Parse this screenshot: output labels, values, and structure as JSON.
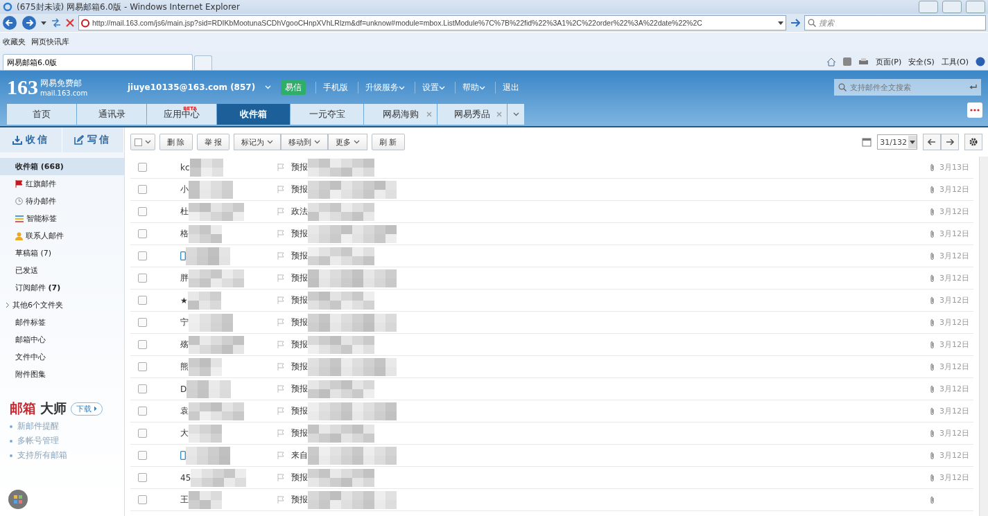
{
  "browser": {
    "title": "(675封未读) 网易邮箱6.0版 - Windows Internet Explorer",
    "address": "http://mail.163.com/js6/main.jsp?sid=RDIKbMootunaSCDhVgooCHnpXVhLRlzm&df=unknow#module=mbox.ListModule%7C%7B%22fid%22%3A1%2C%22order%22%3A%22date%22%2C",
    "search_placeholder": "搜索",
    "favorites": [
      "收藏夹",
      "网页快讯库"
    ],
    "tab": "网易邮箱6.0版",
    "commands": [
      "页面(P)",
      "安全(S)",
      "工具(O)"
    ]
  },
  "header": {
    "logo_number": "163",
    "logo_name": "网易免费邮",
    "logo_domain": "mail.163.com",
    "account": "jiuye10135@163.com (857)",
    "yixin": "易信",
    "links": [
      {
        "label": "手机版",
        "dropdown": false
      },
      {
        "label": "升级服务",
        "dropdown": true
      },
      {
        "label": "设置",
        "dropdown": true
      },
      {
        "label": "帮助",
        "dropdown": true
      },
      {
        "label": "退出",
        "dropdown": false
      }
    ],
    "search_placeholder": "支持邮件全文搜索"
  },
  "tabs": [
    {
      "label": "首页",
      "selected": false,
      "closable": false
    },
    {
      "label": "通讯录",
      "selected": false,
      "closable": false
    },
    {
      "label": "应用中心",
      "selected": false,
      "badge": "BETA",
      "closable": false
    },
    {
      "label": "收件箱",
      "selected": true,
      "closable": false
    },
    {
      "label": "一元夺宝",
      "selected": false,
      "closable": false
    },
    {
      "label": "网易海购",
      "selected": false,
      "closable": true
    },
    {
      "label": "网易秀品",
      "selected": false,
      "closable": true
    }
  ],
  "sidebar": {
    "receive": "收信",
    "write": "写信",
    "folders": [
      {
        "label": "收件箱 (668)",
        "kind": "plain",
        "selected": true,
        "expandable": false
      },
      {
        "label": "红旗邮件",
        "kind": "flag",
        "selected": false,
        "expandable": false
      },
      {
        "label": "待办邮件",
        "kind": "clock",
        "selected": false,
        "expandable": false
      },
      {
        "label": "智能标签",
        "kind": "tags",
        "selected": false,
        "expandable": false
      },
      {
        "label": "联系人邮件",
        "kind": "contact",
        "selected": false,
        "expandable": false
      },
      {
        "label": "草稿箱 (7)",
        "kind": "plain",
        "selected": false,
        "expandable": false
      },
      {
        "label": "已发送",
        "kind": "plain",
        "selected": false,
        "expandable": false
      },
      {
        "label": "订阅邮件 **(7)**",
        "kind": "plain",
        "selected": false,
        "expandable": false
      },
      {
        "label": "其他6个文件夹",
        "kind": "plain",
        "selected": false,
        "expandable": true
      },
      {
        "label": "邮件标签",
        "kind": "plain",
        "selected": false,
        "expandable": false
      },
      {
        "label": "邮箱中心",
        "kind": "plain",
        "selected": false,
        "expandable": false
      },
      {
        "label": "文件中心",
        "kind": "plain",
        "selected": false,
        "expandable": false
      },
      {
        "label": "附件图集",
        "kind": "plain",
        "selected": false,
        "expandable": false
      }
    ],
    "promo": {
      "title": [
        "邮箱",
        "大师"
      ],
      "button": "下载",
      "features": [
        "新邮件提醒",
        "多帐号管理",
        "支持所有邮箱"
      ]
    }
  },
  "toolbar": {
    "buttons": [
      {
        "label": "删 除",
        "dropdown": false,
        "group": false
      },
      {
        "label": "举 报",
        "dropdown": false,
        "group": false
      },
      {
        "label": "标记为",
        "dropdown": true,
        "group": true
      },
      {
        "label": "移动到",
        "dropdown": true,
        "group": true
      },
      {
        "label": "更多",
        "dropdown": true,
        "group": true
      },
      {
        "label": "刷 新",
        "dropdown": false,
        "group": false
      }
    ],
    "pager": "31/132"
  },
  "rows": [
    {
      "checked": false,
      "kind": "text",
      "sender": "kc",
      "subject": "预报",
      "attachment": true,
      "date": "3月13日"
    },
    {
      "checked": false,
      "kind": "text",
      "sender": "小",
      "subject": "预报",
      "attachment": true,
      "date": "3月12日"
    },
    {
      "checked": false,
      "kind": "text",
      "sender": "杜",
      "subject": "政法",
      "attachment": true,
      "date": "3月12日"
    },
    {
      "checked": false,
      "kind": "text",
      "sender": "格",
      "subject": "预报",
      "attachment": true,
      "date": "3月12日"
    },
    {
      "checked": false,
      "kind": "phone",
      "subject": "预报",
      "attachment": true,
      "date": "3月12日"
    },
    {
      "checked": false,
      "kind": "text",
      "sender": "胖",
      "subject": "预报",
      "attachment": true,
      "date": "3月12日"
    },
    {
      "checked": false,
      "kind": "text",
      "sender": "★",
      "subject": "预报",
      "attachment": true,
      "date": "3月12日"
    },
    {
      "checked": false,
      "kind": "text",
      "sender": "宁",
      "subject": "预报",
      "attachment": true,
      "date": "3月12日"
    },
    {
      "checked": false,
      "kind": "text",
      "sender": "殇",
      "subject": "预报",
      "attachment": true,
      "date": "3月12日"
    },
    {
      "checked": false,
      "kind": "text",
      "sender": "熊",
      "subject": "预报",
      "attachment": true,
      "date": "3月12日"
    },
    {
      "checked": false,
      "kind": "text",
      "sender": "D",
      "subject": "预报",
      "attachment": true,
      "date": "3月12日"
    },
    {
      "checked": false,
      "kind": "text",
      "sender": "袁",
      "subject": "预报",
      "attachment": true,
      "date": "3月12日"
    },
    {
      "checked": false,
      "kind": "text",
      "sender": "大",
      "subject": "预报",
      "attachment": true,
      "date": "3月12日"
    },
    {
      "checked": false,
      "kind": "phone",
      "subject": "来自",
      "attachment": true,
      "date": "3月12日"
    },
    {
      "checked": false,
      "kind": "text",
      "sender": "45",
      "subject": "预报",
      "attachment": true,
      "date": "3月12日"
    },
    {
      "checked": false,
      "kind": "text",
      "sender": "王",
      "subject": "预报",
      "attachment": true
    }
  ]
}
